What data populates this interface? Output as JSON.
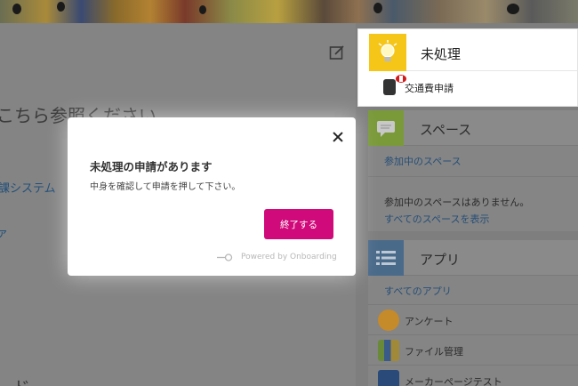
{
  "pending": {
    "title": "未処理",
    "item_label": "交通費申請"
  },
  "space": {
    "title": "スペース",
    "tab_link": "参加中のスペース",
    "empty_text": "参加中のスペースはありません。",
    "show_all": "すべてのスペースを表示"
  },
  "apps": {
    "title": "アプリ",
    "all_link": "すべてのアプリ",
    "items": [
      {
        "label": "アンケート",
        "icon": "survey-icon",
        "color": "#c58a2a"
      },
      {
        "label": "ファイル管理",
        "icon": "file-binders-icon",
        "color": "#6a8a3a"
      },
      {
        "label": "メーカーページテスト",
        "icon": "notebook-icon",
        "color": "#2a4a7a"
      }
    ]
  },
  "main": {
    "heading": "こちら参照ください",
    "link1": "課システム",
    "link2": "ァ",
    "bottom_heading": "ード"
  },
  "modal": {
    "title": "未処理の申請があります",
    "body": "中身を確認して申請を押して下さい。",
    "finish_button": "終了する",
    "powered_by": "Powered by Onboarding"
  },
  "colors": {
    "accent": "#d00a7a",
    "bulb": "#f5c518",
    "link": "#2a5a8a"
  }
}
